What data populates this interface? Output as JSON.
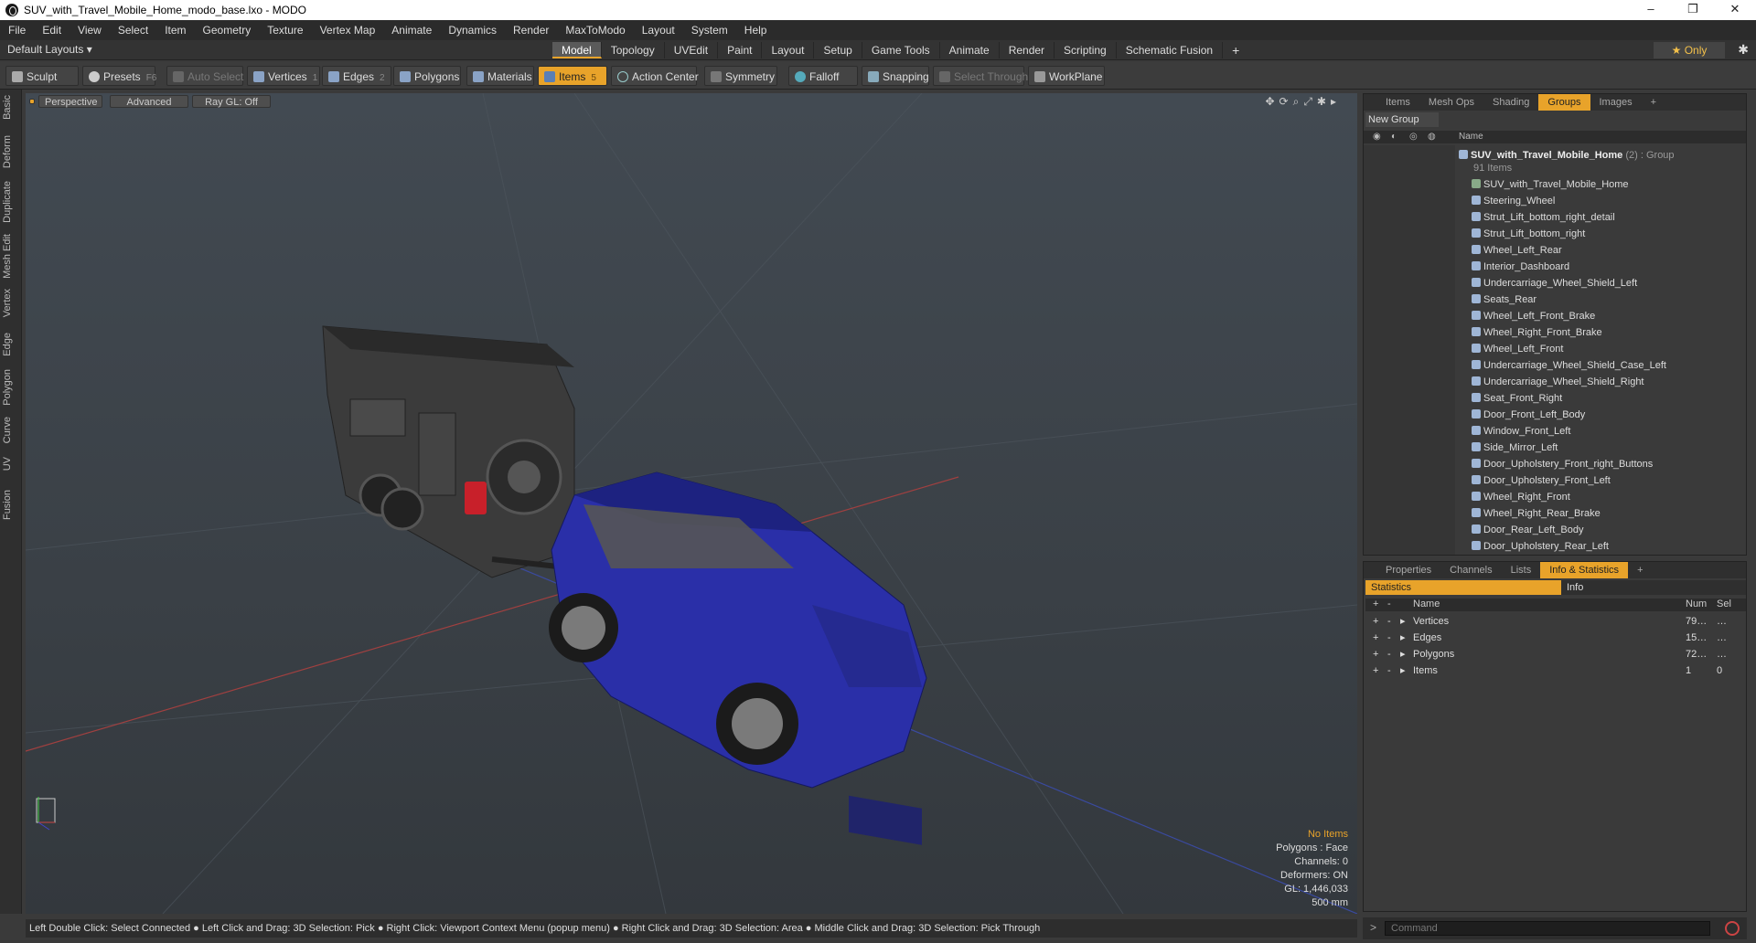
{
  "window": {
    "title": "SUV_with_Travel_Mobile_Home_modo_base.lxo - MODO",
    "controls": [
      "–",
      "❐",
      "✕"
    ]
  },
  "menu": [
    "File",
    "Edit",
    "View",
    "Select",
    "Item",
    "Geometry",
    "Texture",
    "Vertex Map",
    "Animate",
    "Dynamics",
    "Render",
    "MaxToModo",
    "Layout",
    "System",
    "Help"
  ],
  "layout": {
    "default_layouts": "Default Layouts ▾",
    "tabs": [
      "Model",
      "Topology",
      "UVEdit",
      "Paint",
      "Layout",
      "Setup",
      "Game Tools",
      "Animate",
      "Render",
      "Scripting",
      "Schematic Fusion"
    ],
    "active_tab": "Model",
    "add": "+",
    "only": "★ Only",
    "gear": "✱"
  },
  "toolbar": {
    "sculpt": "Sculpt",
    "presets": "Presets",
    "presets_key": "F6",
    "auto_select": "Auto Select",
    "vertices": "Vertices",
    "vertices_num": "1",
    "edges": "Edges",
    "edges_num": "2",
    "polygons": "Polygons",
    "materials": "Materials",
    "items": "Items",
    "items_num": "5",
    "action_center": "Action Center",
    "symmetry": "Symmetry",
    "falloff": "Falloff",
    "snapping": "Snapping",
    "select_through": "Select Through",
    "workplane": "WorkPlane"
  },
  "left_tabs": [
    "Basic",
    "Deform",
    "Duplicate",
    "Mesh Edit",
    "Vertex",
    "Edge",
    "Polygon",
    "Curve",
    "UV",
    "Fusion"
  ],
  "viewport": {
    "perspective": "Perspective",
    "advanced": "Advanced",
    "raygl": "Ray GL: Off",
    "info": {
      "no_items": "No Items",
      "polygons": "Polygons : Face",
      "channels": "Channels: 0",
      "deformers": "Deformers: ON",
      "gl": "GL: 1,446,033",
      "scale": "500 mm"
    }
  },
  "status": "Left Double Click: Select Connected ● Left Click and Drag: 3D Selection: Pick ● Right Click: Viewport Context Menu (popup menu) ● Right Click and Drag: 3D Selection: Area ● Middle Click and Drag: 3D Selection: Pick Through",
  "groups_panel": {
    "tabs": [
      "Items",
      "Mesh Ops",
      "Shading",
      "Groups",
      "Images"
    ],
    "active_tab": "Groups",
    "new_group": "New Group",
    "col_name": "Name",
    "root": {
      "name": "SUV_with_Travel_Mobile_Home",
      "count": "(2)",
      "type": ": Group",
      "items": "91 Items"
    },
    "items": [
      "SUV_with_Travel_Mobile_Home",
      "Steering_Wheel",
      "Strut_Lift_bottom_right_detail",
      "Strut_Lift_bottom_right",
      "Wheel_Left_Rear",
      "Interior_Dashboard",
      "Undercarriage_Wheel_Shield_Left",
      "Seats_Rear",
      "Wheel_Left_Front_Brake",
      "Wheel_Right_Front_Brake",
      "Wheel_Left_Front",
      "Undercarriage_Wheel_Shield_Case_Left",
      "Undercarriage_Wheel_Shield_Right",
      "Seat_Front_Right",
      "Door_Front_Left_Body",
      "Window_Front_Left",
      "Side_Mirror_Left",
      "Door_Upholstery_Front_right_Buttons",
      "Door_Upholstery_Front_Left",
      "Wheel_Right_Front",
      "Wheel_Right_Rear_Brake",
      "Door_Rear_Left_Body",
      "Door_Upholstery_Rear_Left"
    ]
  },
  "stats_panel": {
    "tabs": [
      "Properties",
      "Channels",
      "Lists",
      "Info & Statistics"
    ],
    "active_tab": "Info & Statistics",
    "statistics": "Statistics",
    "info": "Info",
    "cols": {
      "name": "Name",
      "num": "Num",
      "sel": "Sel"
    },
    "rows": [
      {
        "name": "Vertices",
        "num": "79…",
        "sel": "…"
      },
      {
        "name": "Edges",
        "num": "15…",
        "sel": "…"
      },
      {
        "name": "Polygons",
        "num": "72…",
        "sel": "…"
      },
      {
        "name": "Items",
        "num": "1",
        "sel": "0"
      }
    ]
  },
  "command": {
    "placeholder": "Command"
  },
  "colors": {
    "accent": "#e8a32a",
    "suv_body": "#2a2fa8",
    "trailer": "#3a3a3a"
  }
}
